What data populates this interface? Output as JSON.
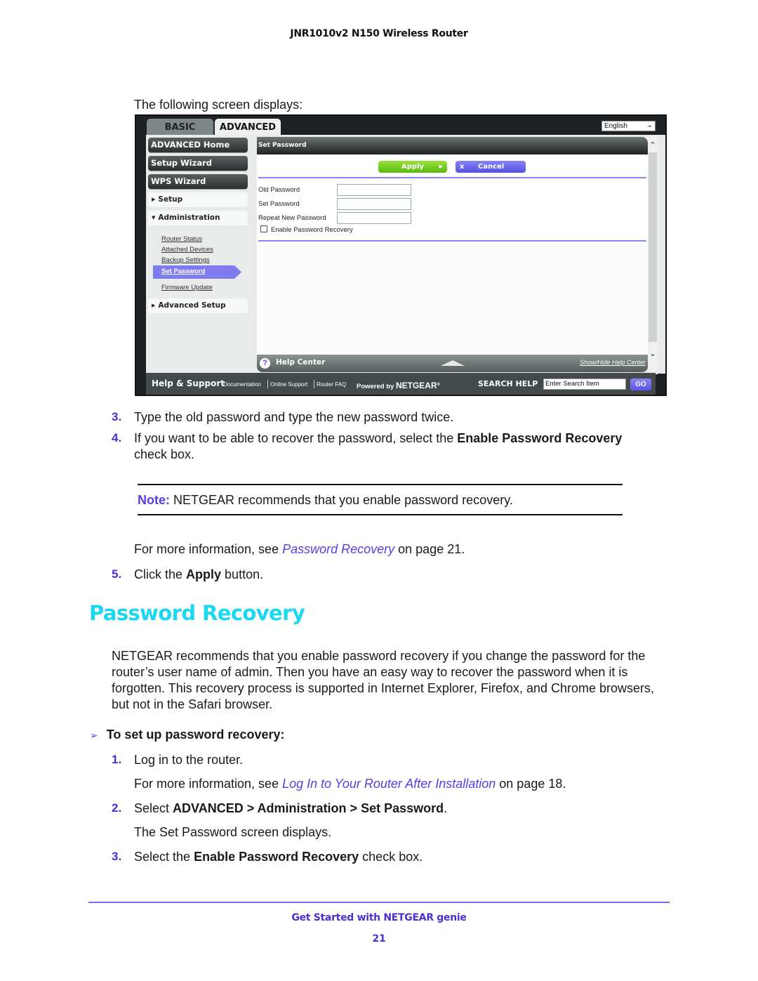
{
  "header": {
    "title": "JNR1010v2 N150 Wireless Router"
  },
  "intro": "The following screen displays:",
  "router_ui": {
    "tabs": [
      {
        "label": "BASIC",
        "active": false
      },
      {
        "label": "ADVANCED",
        "active": true
      }
    ],
    "language": {
      "selected": "English",
      "icon": "chevron-down-icon"
    },
    "sidebar": {
      "primary": [
        "ADVANCED Home",
        "Setup Wizard",
        "WPS Wizard"
      ],
      "sections": [
        {
          "label": "Setup",
          "expanded": false
        },
        {
          "label": "Administration",
          "expanded": true
        },
        {
          "label": "Advanced Setup",
          "expanded": false
        }
      ],
      "admin_links": [
        "Router Status",
        "Attached Devices",
        "Backup Settings",
        "Set Password",
        "Firmware Update"
      ],
      "active_link": "Set Password"
    },
    "content": {
      "title": "Set Password",
      "apply_label": "Apply",
      "cancel_label": "Cancel",
      "cancel_icon": "x",
      "fields": [
        {
          "label": "Old Password",
          "value": ""
        },
        {
          "label": "Set Password",
          "value": ""
        },
        {
          "label": "Repeat New Password",
          "value": ""
        }
      ],
      "checkbox": {
        "label": "Enable Password Recovery",
        "checked": false
      }
    },
    "help_center": {
      "title": "Help Center",
      "icon": "?",
      "toggle_label": "Show/Hide Help Center"
    },
    "footer": {
      "title": "Help & Support",
      "links": [
        "Documentation",
        "Online Support",
        "Router FAQ"
      ],
      "powered_prefix": "Powered by",
      "brand": "NETGEAR",
      "reg": "®",
      "search_label": "SEARCH HELP",
      "search_placeholder": "Enter Search Item",
      "go_label": "GO"
    }
  },
  "steps_a": [
    {
      "num": "3.",
      "text": "Type the old password and type the new password twice."
    },
    {
      "num": "4.",
      "pre": "If you want to be able to recover the password, select the ",
      "bold": "Enable Password Recovery",
      "line2": "check box."
    }
  ],
  "note": {
    "label": "Note:",
    "text": " NETGEAR recommends that you enable password recovery."
  },
  "more_info_1": {
    "pre": "For more information, see ",
    "link": "Password Recovery",
    "post": " on page 21."
  },
  "step5": {
    "num": "5.",
    "pre": "Click the ",
    "bold": "Apply",
    "post": " button."
  },
  "section": {
    "title": "Password Recovery",
    "paragraph": "NETGEAR recommends that you enable password recovery if you change the password for the router’s user name of admin. Then you have an easy way to recover the password when it is forgotten. This recovery process is supported in Internet Explorer, Firefox, and Chrome browsers, but not in the Safari browser.",
    "procedure_icon": "➢",
    "procedure_title": "To set up password recovery:",
    "steps": [
      {
        "num": "1.",
        "text": "Log in to the router."
      },
      {
        "pre": "For more information, see ",
        "link": "Log In to Your Router After Installation",
        "post": " on page 18."
      },
      {
        "num": "2.",
        "pre": "Select ",
        "b1": "ADVANCED > Administration > Set Password",
        "post": "."
      },
      {
        "text": "The Set Password screen displays."
      },
      {
        "num": "3.",
        "pre": "Select the ",
        "bold": "Enable Password Recovery",
        "post": " check box."
      }
    ]
  },
  "page_footer": {
    "title": "Get Started with NETGEAR genie",
    "page": "21"
  },
  "colors": {
    "accent": "#4b2fd6",
    "heading": "#1ad8f2",
    "link": "#5a3be8",
    "apply_green": "#6cc81a",
    "cancel_blue": "#5a55e6"
  }
}
